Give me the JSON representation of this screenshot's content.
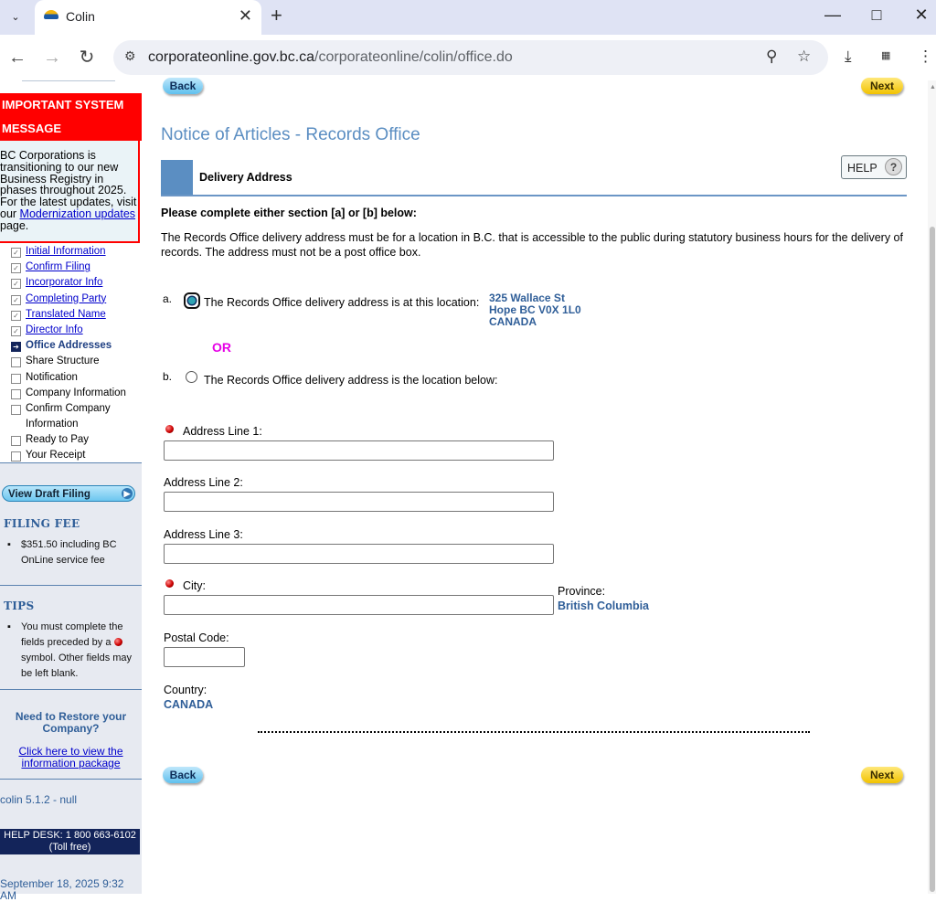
{
  "browser": {
    "tab_title": "Colin",
    "url_host": "corporateonline.gov.bc.ca",
    "url_path": "/corporateonline/colin/office.do"
  },
  "sidebar": {
    "system_message_title_1": "IMPORTANT SYSTEM",
    "system_message_title_2": "MESSAGE",
    "system_message_body": "BC Corporations is transitioning to our new Business Registry in phases throughout 2025. For the latest updates, visit our ",
    "system_message_link": "Modernization updates",
    "system_message_tail": " page.",
    "steps": [
      {
        "label": "Initial Information",
        "state": "done"
      },
      {
        "label": "Confirm Filing",
        "state": "done"
      },
      {
        "label": "Incorporator Info",
        "state": "done"
      },
      {
        "label": "Completing Party",
        "state": "done"
      },
      {
        "label": "Translated Name",
        "state": "done"
      },
      {
        "label": "Director Info",
        "state": "done"
      },
      {
        "label": "Office Addresses",
        "state": "current"
      },
      {
        "label": "Share Structure",
        "state": "todo"
      },
      {
        "label": "Notification",
        "state": "todo"
      },
      {
        "label": "Company Information",
        "state": "todo"
      },
      {
        "label": "Confirm Company",
        "state": "todo"
      },
      {
        "label": "Information",
        "state": "todo"
      },
      {
        "label": "Ready to Pay",
        "state": "todo"
      },
      {
        "label": "Your Receipt",
        "state": "todo"
      }
    ],
    "view_draft_label": "View Draft Filing",
    "filing_fee_title": "FILING FEE",
    "filing_fee_text": "$351.50 including BC OnLine service fee",
    "tips_title": "TIPS",
    "tips_text_1": "You must complete the fields preceded by a",
    "tips_text_2": "symbol. Other fields may be left blank.",
    "restore_title": "Need to Restore your Company?",
    "restore_link": "Click here to view the information package",
    "version": "colin 5.1.2 - null",
    "helpdesk_1": "HELP DESK: 1 800 663-6102",
    "helpdesk_2": "(Toll free)",
    "datetime_1": "September 18, 2025 9:32",
    "datetime_2": "AM"
  },
  "main": {
    "back_label": "Back",
    "next_label": "Next",
    "page_title": "Notice of Articles - Records Office",
    "section_title": "Delivery Address",
    "help_label": "HELP",
    "help_q": "?",
    "instruction": "Please complete either section [a] or [b] below:",
    "description": "The Records Office delivery address must be for a location in B.C. that is accessible to the public during statutory business hours for the delivery of records. The address must not be a post office box.",
    "option_a_letter": "a.",
    "option_a_text": "The Records Office delivery address is at this location:",
    "option_a_selected": true,
    "address_line1": "325 Wallace St",
    "address_line2": "Hope  BC  V0X 1L0",
    "address_line3": "CANADA",
    "or_label": "OR",
    "option_b_letter": "b.",
    "option_b_text": "The Records Office delivery address is the location below:",
    "fields": {
      "address1_label": "Address Line 1:",
      "address1_value": "",
      "address2_label": "Address Line 2:",
      "address2_value": "",
      "address3_label": "Address Line 3:",
      "address3_value": "",
      "city_label": "City:",
      "city_value": "",
      "province_label": "Province:",
      "province_value": "British Columbia",
      "postal_label": "Postal Code:",
      "postal_value": "",
      "country_label": "Country:",
      "country_value": "CANADA"
    }
  },
  "colors": {
    "accent": "#5b8ec2",
    "alert": "#ff0000",
    "or": "#e600e6",
    "navy": "#13245a"
  }
}
